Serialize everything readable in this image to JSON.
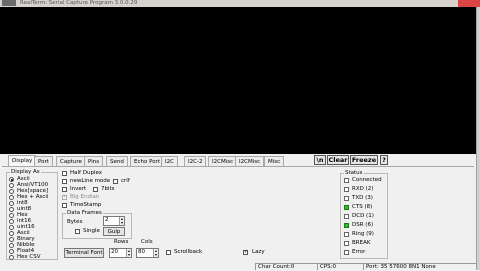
{
  "window": {
    "title": "RealTerm: Serial Capture Program 3.0.0.29"
  },
  "tabs": [
    "Display",
    "Port",
    "Capture",
    "Pins",
    "Send",
    "Echo Port",
    "I2C",
    "I2C-2",
    "I2CMisc",
    "I2CMisc",
    "Misc"
  ],
  "commands": {
    "newline": "\\n",
    "clear": "Clear",
    "freeze": "Freeze",
    "help": "?"
  },
  "display_as": {
    "title": "Display As",
    "options": [
      "Ascii",
      "Ansi/VT100",
      "Hex[space]",
      "Hex + Ascii",
      "int8",
      "uint8",
      "Hex",
      "int16",
      "uint16",
      "Ascii",
      "Binary",
      "Nibble",
      "Float4",
      "Hex CSV"
    ],
    "selected": 0
  },
  "options": {
    "half_duplex": "Half Duplex",
    "newline_mode": "newLine mode",
    "invert": "Invert",
    "big_endian": "Big Endian",
    "timestamp": "TimeStamp",
    "crlf": "crlf",
    "seven_bits": "7bits"
  },
  "data_frames": {
    "title": "Data Frames",
    "bytes_label": "Bytes",
    "bytes_value": "2",
    "single_label": "Single",
    "gulp_label": "Gulp"
  },
  "terminal": {
    "font_button": "Terminal Font",
    "rows_label": "Rows",
    "rows_value": "20",
    "cols_label": "Cols",
    "cols_value": "80",
    "scrollback": "Scrollback",
    "lazy": "Lazy"
  },
  "status": {
    "title": "Status",
    "items": [
      {
        "label": "Connected",
        "on": false
      },
      {
        "label": "RXD (2)",
        "on": false
      },
      {
        "label": "TXD (3)",
        "on": false
      },
      {
        "label": "CTS (8)",
        "on": true
      },
      {
        "label": "DCD (1)",
        "on": false
      },
      {
        "label": "DSR (6)",
        "on": true
      },
      {
        "label": "Ring (9)",
        "on": false
      },
      {
        "label": "BREAK",
        "on": false
      },
      {
        "label": "Error",
        "on": false
      }
    ]
  },
  "statusbar": {
    "chars": "Char Count:0",
    "cps": "CPS:0",
    "port": "Port: 35  57600 8N1 None"
  },
  "colors": {
    "terminal_bg": "#000000",
    "led_on": "#2fbf2f",
    "close": "#dd4444"
  }
}
